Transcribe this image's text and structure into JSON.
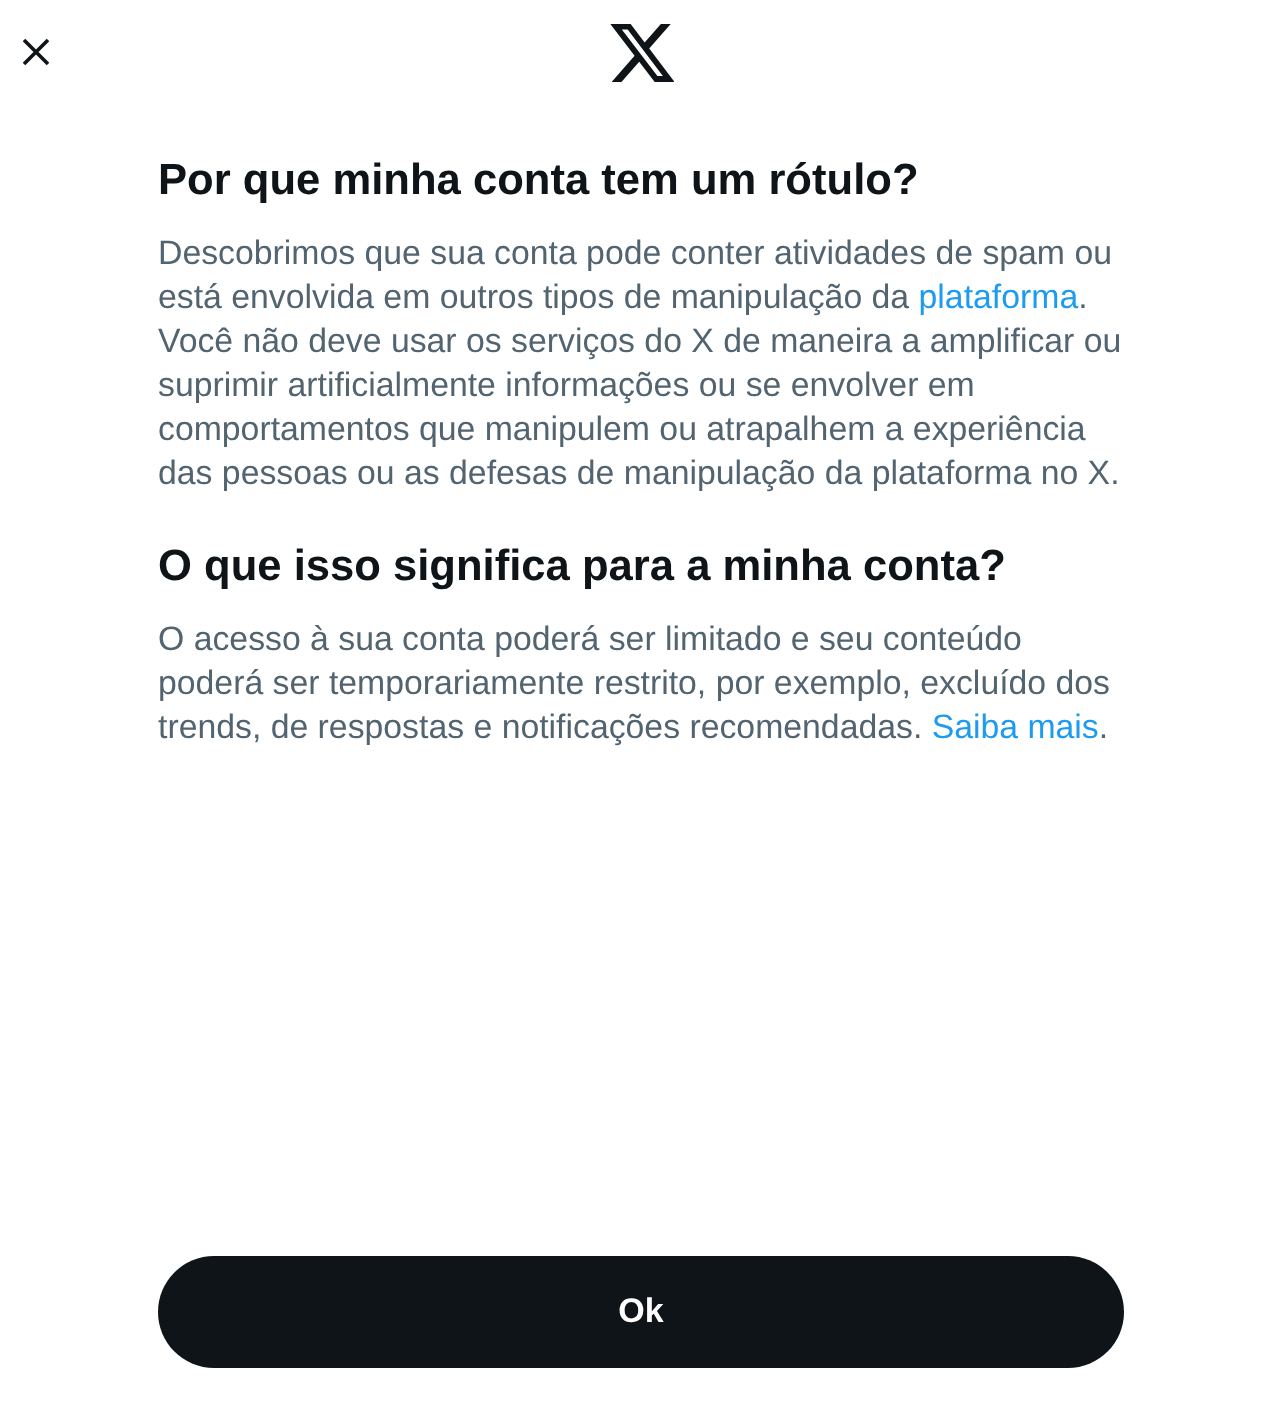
{
  "sections": [
    {
      "heading": "Por que minha conta tem um rótulo?",
      "body": [
        {
          "kind": "text",
          "text": "Descobrimos que sua conta pode conter atividades de spam ou está envolvida em outros tipos de manipulação da "
        },
        {
          "kind": "link",
          "text": "plataforma"
        },
        {
          "kind": "text",
          "text": ". Você não deve usar os serviços do X de maneira a amplificar ou suprimir artificialmente informações ou se envolver em comportamentos que manipulem ou atrapalhem a experiência das pessoas ou as defesas de manipulação da plataforma no X."
        }
      ]
    },
    {
      "heading": "O que isso significa para a minha conta?",
      "body": [
        {
          "kind": "text",
          "text": "O acesso à sua conta poderá ser limitado e seu conteúdo poderá ser temporariamente restrito, por exemplo, excluído dos trends, de respostas e notificações recomendadas. "
        },
        {
          "kind": "link",
          "text": "Saiba mais"
        },
        {
          "kind": "text",
          "text": "."
        }
      ]
    }
  ],
  "button": {
    "label": "Ok"
  }
}
